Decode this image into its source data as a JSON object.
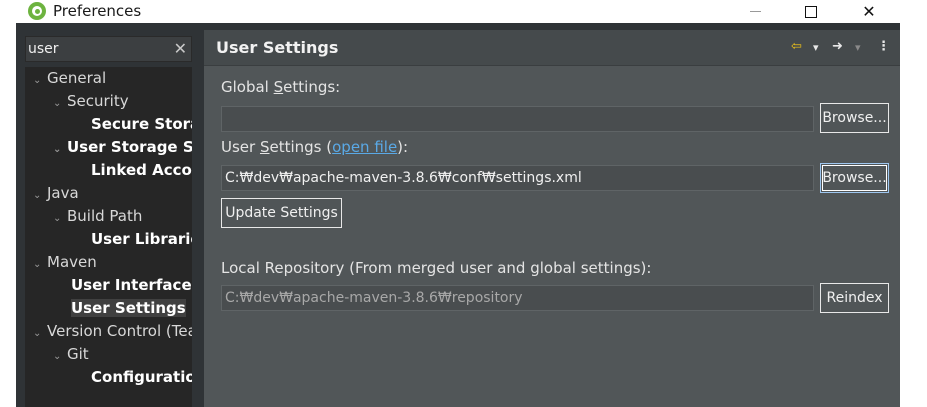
{
  "window": {
    "title": "Preferences",
    "minimize_label": "",
    "maximize_label": "",
    "close_label": "✕"
  },
  "filter": {
    "value": "user",
    "clear_label": "✕"
  },
  "tree": [
    {
      "label": "General",
      "bold": false,
      "chevron": "⌄"
    },
    {
      "label": "Security",
      "bold": false,
      "chevron": "⌄"
    },
    {
      "label": "Secure Storage",
      "bold": true,
      "chevron": ""
    },
    {
      "label": "User Storage Service",
      "bold": true,
      "chevron": "⌄"
    },
    {
      "label": "Linked Accounts",
      "bold": true,
      "chevron": ""
    },
    {
      "label": "Java",
      "bold": false,
      "chevron": "⌄"
    },
    {
      "label": "Build Path",
      "bold": false,
      "chevron": "⌄"
    },
    {
      "label": "User Libraries",
      "bold": true,
      "chevron": ""
    },
    {
      "label": "Maven",
      "bold": false,
      "chevron": "⌄"
    },
    {
      "label": "User Interface",
      "bold": true,
      "chevron": ""
    },
    {
      "label": "User Settings",
      "bold": true,
      "chevron": "",
      "selected": true
    },
    {
      "label": "Version Control (Team)",
      "bold": false,
      "chevron": "⌄"
    },
    {
      "label": "Git",
      "bold": false,
      "chevron": "⌄"
    },
    {
      "label": "Configuration",
      "bold": true,
      "chevron": ""
    }
  ],
  "page": {
    "title": "User Settings",
    "back_icon": "⇦",
    "forward_icon": "➜",
    "menu_icon": "⋮",
    "dropdown_icon": "▾"
  },
  "global": {
    "label_prefix": "Global ",
    "label_mnemonic": "S",
    "label_suffix": "ettings:",
    "value": "",
    "browse_label": "Browse..."
  },
  "user": {
    "label_prefix": "User ",
    "label_mnemonic": "S",
    "label_mid": "ettings (",
    "open_file_label": "open file",
    "label_suffix": "):",
    "value": "C:₩dev₩apache-maven-3.8.6₩conf₩settings.xml",
    "browse_label": "Browse..."
  },
  "update_label": "Update Settings",
  "local": {
    "label": "Local Repository (From merged user and global settings):",
    "value": "C:₩dev₩apache-maven-3.8.6₩repository",
    "reindex_label": "Reindex"
  }
}
